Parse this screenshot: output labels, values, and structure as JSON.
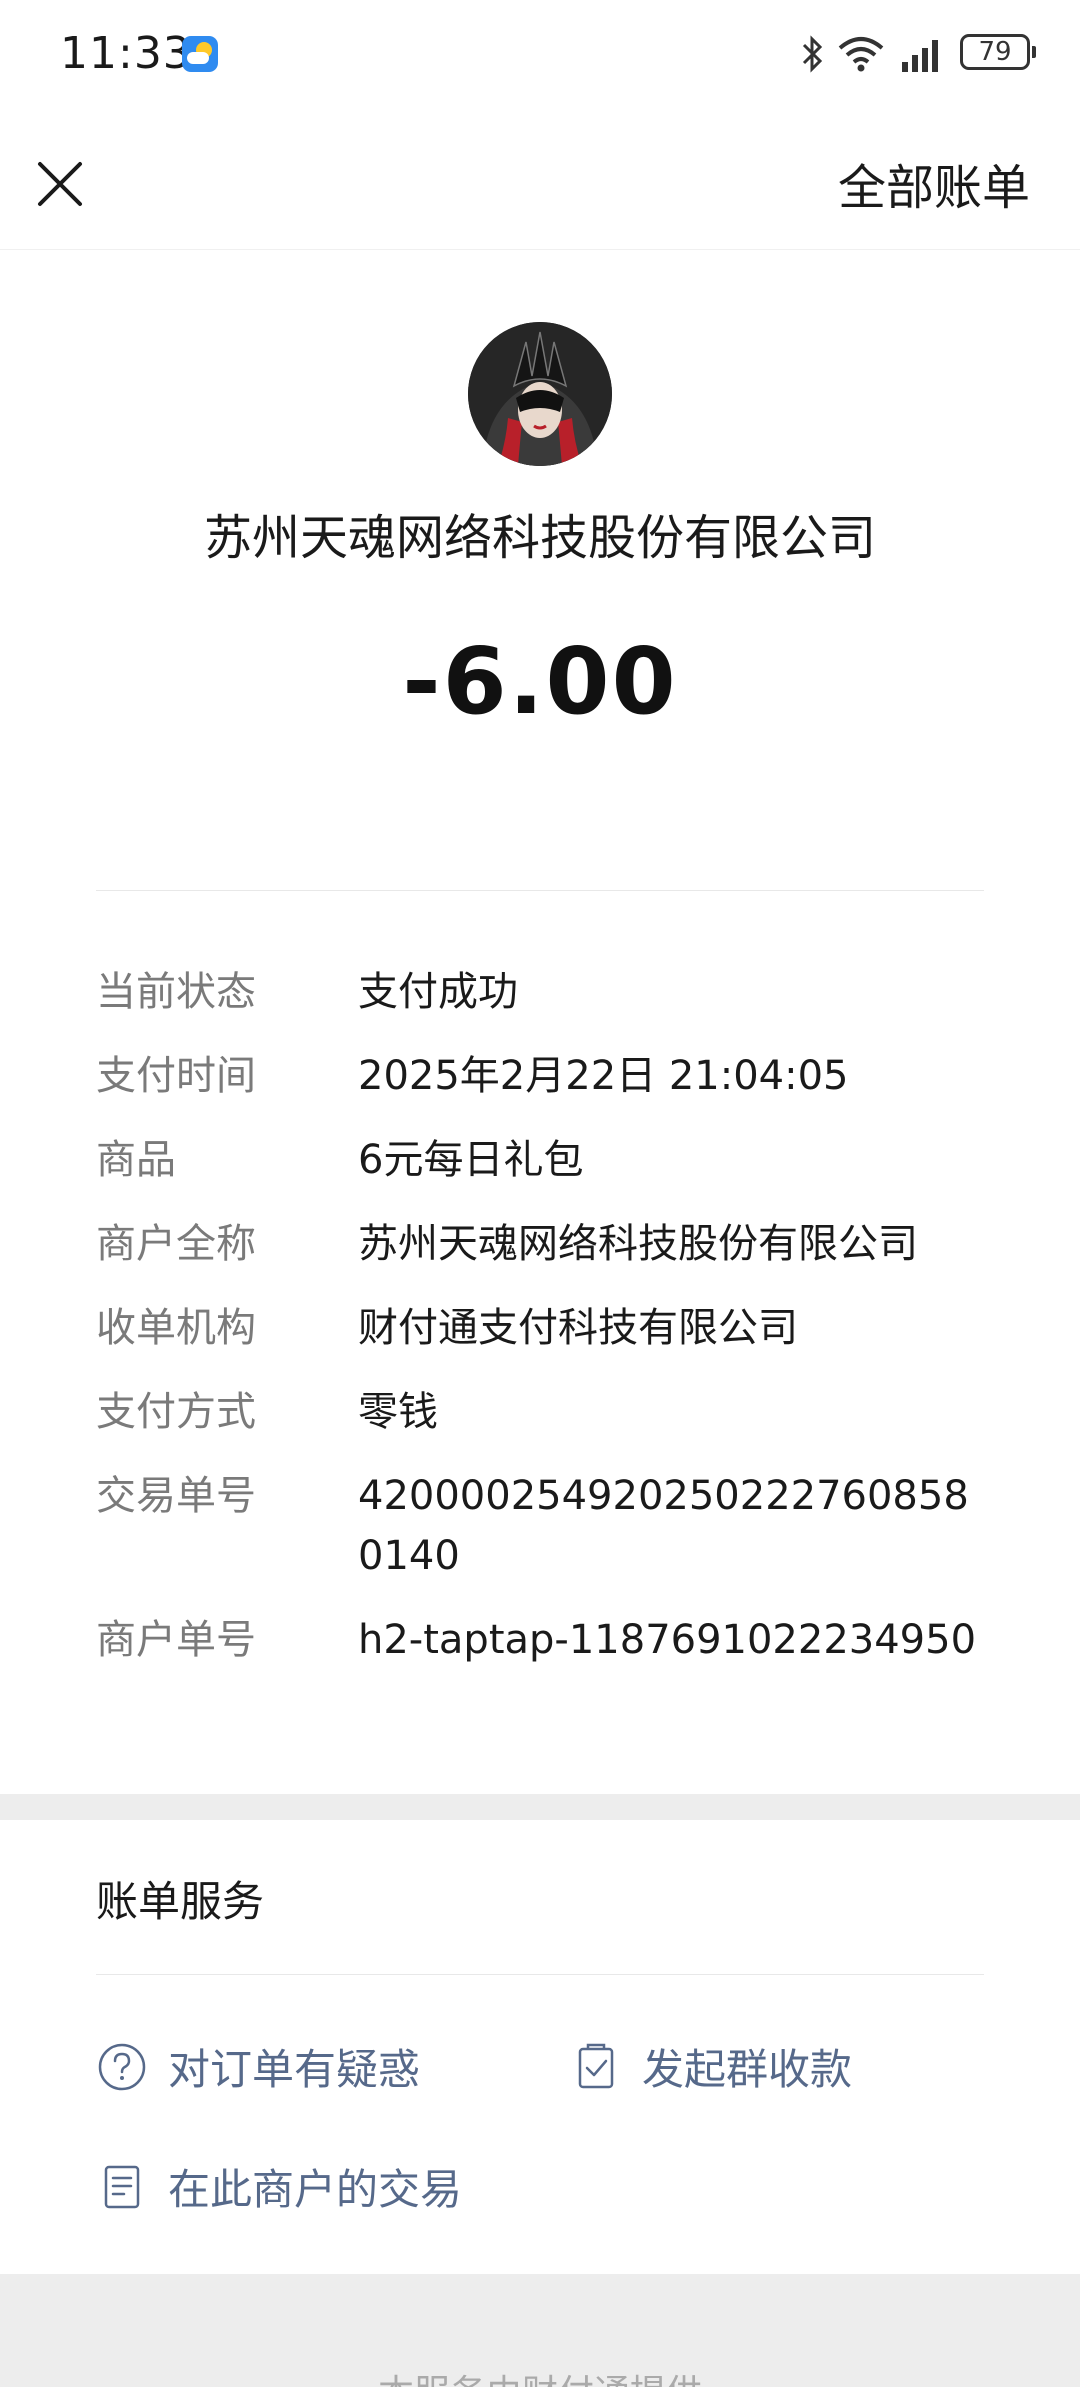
{
  "status_bar": {
    "time": "11:33",
    "battery": "79"
  },
  "header": {
    "all_bills": "全部账单"
  },
  "merchant": {
    "name": "苏州天魂网络科技股份有限公司",
    "amount": "-6.00"
  },
  "details": [
    {
      "label": "当前状态",
      "value": "支付成功"
    },
    {
      "label": "支付时间",
      "value": "2025年2月22日 21:04:05"
    },
    {
      "label": "商品",
      "value": "6元每日礼包"
    },
    {
      "label": "商户全称",
      "value": "苏州天魂网络科技股份有限公司"
    },
    {
      "label": "收单机构",
      "value": "财付通支付科技有限公司"
    },
    {
      "label": "支付方式",
      "value": "零钱"
    },
    {
      "label": "交易单号",
      "value": "420000254920250222760858014​0"
    },
    {
      "label": "商户单号",
      "value": "h2-taptap-1187691022234950"
    }
  ],
  "services": {
    "title": "账单服务",
    "items": [
      {
        "label": "对订单有疑惑",
        "icon": "question-circle-icon"
      },
      {
        "label": "发起群收款",
        "icon": "checklist-icon"
      },
      {
        "label": "在此商户的交易",
        "icon": "document-icon"
      }
    ]
  },
  "footer": {
    "text": "本服务由财付通提供"
  },
  "colors": {
    "link": "#56698a",
    "label": "#7a7a7a",
    "divider": "#e8e8e8",
    "section_bg": "#ededed"
  }
}
